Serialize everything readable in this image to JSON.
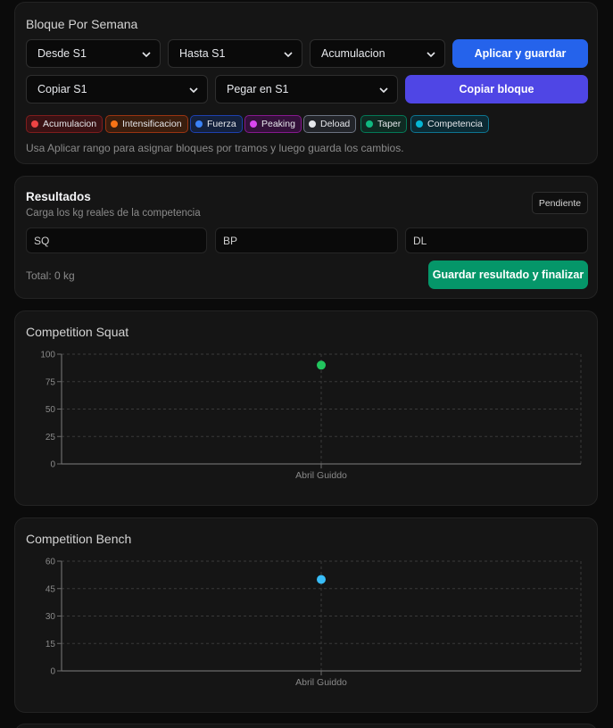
{
  "bloque": {
    "title": "Bloque Por Semana",
    "desde": "Desde S1",
    "hasta": "Hasta S1",
    "tipo": "Acumulacion",
    "apply_label": "Aplicar y guardar",
    "copiar": "Copiar S1",
    "pegar": "Pegar en S1",
    "copy_label": "Copiar bloque",
    "chips": [
      {
        "label": "Acumulacion",
        "color": "#ef4444",
        "bg": "#3a1214",
        "border": "#7f1d1d"
      },
      {
        "label": "Intensificacion",
        "color": "#f97316",
        "bg": "#3a1e0e",
        "border": "#9a3412"
      },
      {
        "label": "Fuerza",
        "color": "#3b82f6",
        "bg": "#14213d",
        "border": "#1e40af"
      },
      {
        "label": "Peaking",
        "color": "#d946ef",
        "bg": "#33113a",
        "border": "#86198f"
      },
      {
        "label": "Deload",
        "color": "#e5e7eb",
        "bg": "#222429",
        "border": "#6b7280"
      },
      {
        "label": "Taper",
        "color": "#10b981",
        "bg": "#0f2a22",
        "border": "#047857"
      },
      {
        "label": "Competencia",
        "color": "#06b6d4",
        "bg": "#0c2a33",
        "border": "#0e7490"
      }
    ],
    "hint": "Usa Aplicar rango para asignar bloques por tramos y luego guarda los cambios."
  },
  "resultados": {
    "title": "Resultados",
    "subtitle": "Carga los kg reales de la competencia",
    "status": "Pendiente",
    "sq_placeholder": "SQ",
    "bp_placeholder": "BP",
    "dl_placeholder": "DL",
    "total": "Total: 0 kg",
    "save_label": "Guardar resultado y finalizar"
  },
  "colors": {
    "apply_button": "#2563eb",
    "copy_button": "#4f46e5",
    "save_button": "#059669"
  },
  "chart_data": [
    {
      "type": "scatter",
      "title": "Competition Squat",
      "categories": [
        "Abril Guiddo"
      ],
      "values": [
        90
      ],
      "ylim": [
        0,
        100
      ],
      "yticks": [
        0,
        25,
        50,
        75,
        100
      ],
      "grid": true,
      "color": "#22c55e"
    },
    {
      "type": "scatter",
      "title": "Competition Bench",
      "categories": [
        "Abril Guiddo"
      ],
      "values": [
        50
      ],
      "ylim": [
        0,
        60
      ],
      "yticks": [
        0,
        15,
        30,
        45,
        60
      ],
      "grid": true,
      "color": "#38bdf8"
    }
  ]
}
